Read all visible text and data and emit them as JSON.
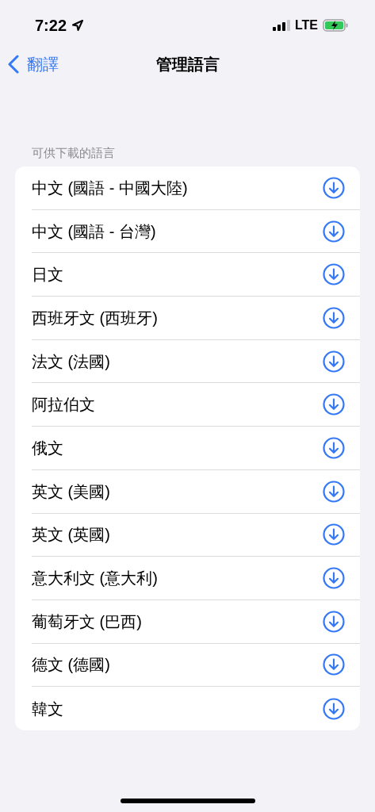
{
  "status_bar": {
    "time": "7:22",
    "network": "LTE"
  },
  "nav": {
    "back": "翻譯",
    "title": "管理語言"
  },
  "section": {
    "header": "可供下載的語言",
    "items": [
      {
        "label": "中文 (國語 - 中國大陸)"
      },
      {
        "label": "中文 (國語 - 台灣)"
      },
      {
        "label": "日文"
      },
      {
        "label": "西班牙文 (西班牙)"
      },
      {
        "label": "法文 (法國)"
      },
      {
        "label": "阿拉伯文"
      },
      {
        "label": "俄文"
      },
      {
        "label": "英文 (美國)"
      },
      {
        "label": "英文 (英國)"
      },
      {
        "label": "意大利文 (意大利)"
      },
      {
        "label": "葡萄牙文 (巴西)"
      },
      {
        "label": "德文 (德國)"
      },
      {
        "label": "韓文"
      }
    ]
  }
}
